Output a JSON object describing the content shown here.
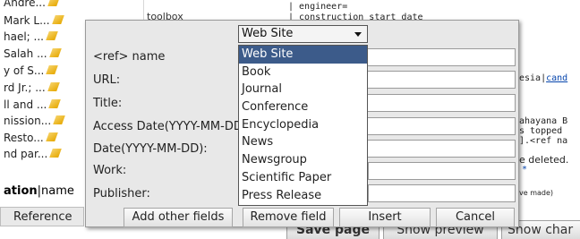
{
  "background": {
    "sidebar_items": [
      "Andre...",
      "Mark L...",
      "hael; ...",
      "Salah ...",
      "y of S...",
      "rd Jr.; ...",
      "ll and ...",
      "nission...",
      "Resto...",
      "nd par..."
    ],
    "heading_prefix": "ation",
    "heading_suffix": "|name",
    "reference_tab": "Reference",
    "toolbox": "toolbox",
    "code_lines": {
      "l0": "| engineer=",
      "l1": "| construction start date",
      "l2": "esia|",
      "l2b": "cand",
      "l3": "ahayana B",
      "l4": "s topped",
      "l5": "].<ref na",
      "l6": "e deleted.",
      "l7": "*",
      "l8": "ve made)"
    },
    "bottom_buttons": {
      "save": "Save page",
      "preview": "Show preview",
      "changes": "Show char"
    }
  },
  "dialog": {
    "select_value": "Web Site",
    "labels": {
      "ref_name": "<ref> name",
      "url": "URL:",
      "title": "Title:",
      "access_date": "Access Date(YYYY-MM-DD):",
      "date": "Date(YYYY-MM-DD):",
      "work": "Work:",
      "publisher": "Publisher:"
    },
    "dropdown_options": [
      "Web Site",
      "Book",
      "Journal",
      "Conference",
      "Encyclopedia",
      "News",
      "Newsgroup",
      "Scientific Paper",
      "Press Release"
    ],
    "buttons": {
      "add": "Add other fields",
      "remove": "Remove field",
      "insert": "Insert",
      "cancel": "Cancel"
    }
  },
  "colors": {
    "selected_option_bg": "#3c5b8a",
    "dialog_bg": "#e8e8e8"
  }
}
